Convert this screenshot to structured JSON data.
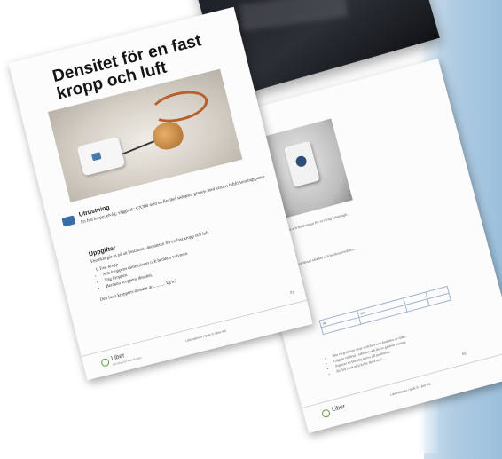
{
  "front_page": {
    "title": "Densitet för en fast kropp och luft",
    "equipment_heading": "Utrustning",
    "equipment_text": "En fast kropp; elvåg; vägglock; CX300 med en flexibel snäppan; gladvis med kraner; luftförtunningspump",
    "tasks_heading": "Uppgifter",
    "tasks_intro": "Försöket går ut på att bestämma densiteten för en fast kropp och luft.",
    "tasks_sub": "Fast kropp",
    "tasks_items": [
      "Mät kroppens dimensioner och beräkna volymen.",
      "Väg kroppen.",
      "Beräkna kroppens densitet."
    ],
    "fill_in": "Den fasta kroppens densitet är ........... kg/m³",
    "page_number": "21",
    "footer_logo": "Liber",
    "footer_logo_sub": "Ett förlag för hela Norden",
    "footer_meta": "Laborationer i fysik © Liber AB"
  },
  "back_page": {
    "table_header_left": "t/s",
    "table_header_right": "s/m",
    "paragraph_1": "Mätresultat och beräkningar för en rörlig luftmängd...",
    "paragraph_2": "Anteckna värdena i tabellen och beräkna resultatet...",
    "bullets": [
      "Rita en graf som visar sträckan som funktion av tiden.",
      "Lägg in värdena i tabellen och läs av grafens lutning.",
      "Anpassa en lämplig kurva till punkterna.",
      "Storlek med utryckelse för 4 m/s² ..."
    ],
    "page_number": "53",
    "footer_logo": "Liber",
    "footer_meta": "Laborationer i fysik © Liber AB"
  }
}
